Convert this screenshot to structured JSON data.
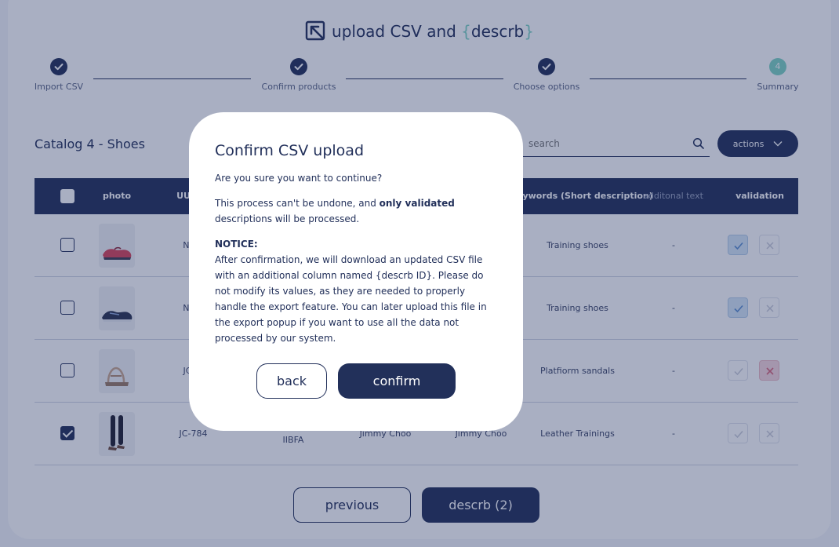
{
  "brand": {
    "prefix": "upload CSV and ",
    "brace_open": "{",
    "name": "descrb",
    "brace_close": "}"
  },
  "stepper": {
    "steps": [
      {
        "label": "Import CSV",
        "status": "done"
      },
      {
        "label": "Confirm products",
        "status": "done"
      },
      {
        "label": "Choose options",
        "status": "done"
      },
      {
        "label": "Summary",
        "status": "current",
        "number": "4"
      }
    ]
  },
  "catalog": {
    "title": "Catalog 4 - Shoes"
  },
  "search": {
    "placeholder": "search"
  },
  "actions": {
    "label": "actions"
  },
  "table": {
    "headers": {
      "photo": "photo",
      "uuid": "UU",
      "keywords": "eywords (Short description)",
      "additional": "additonal text",
      "validation": "validation"
    },
    "rows": [
      {
        "uuid": "NI",
        "col3": "",
        "col4": "",
        "col5": "",
        "keywords": "Training shoes",
        "additional": "-",
        "checked": false,
        "image": "red sneaker",
        "validation": "validated"
      },
      {
        "uuid": "NI",
        "col3": "",
        "col4": "",
        "col5": "",
        "keywords": "Training shoes",
        "additional": "-",
        "checked": false,
        "image": "dark sneaker",
        "validation": "validated"
      },
      {
        "uuid": "JC",
        "col3": "",
        "col4": "",
        "col5": "",
        "keywords": "Platfiorm sandals",
        "additional": "-",
        "checked": false,
        "image": "sandal",
        "validation": "rejected"
      },
      {
        "uuid": "JC-784",
        "col3": "IIBFA",
        "col4": "Jimmy Choo",
        "col5": "Jimmy Choo",
        "keywords": "Leather Trainings",
        "additional": "-",
        "checked": true,
        "image": "boots",
        "validation": "pending"
      }
    ]
  },
  "footer": {
    "previous": "previous",
    "descrb": "descrb (2)"
  },
  "modal": {
    "title": "Confirm CSV upload",
    "question": "Are you sure you want to continue?",
    "line_a": "This process can't be undone, and ",
    "line_bold": "only validated",
    "line_b": " descriptions will be processed.",
    "notice_title": "NOTICE:",
    "notice_body": "After confirmation, we will download an updated CSV file with an additional column named {descrb ID}. Please do not modify its values, as they are needed to properly handle the export feature. You can later upload this file in the export popup if you want to use all the data not processed by our system.",
    "back": "back",
    "confirm": "confirm"
  },
  "colors": {
    "primary": "#22305a",
    "accent": "#7fd3c4",
    "overlay": "rgba(30,45,95,0.38)"
  }
}
